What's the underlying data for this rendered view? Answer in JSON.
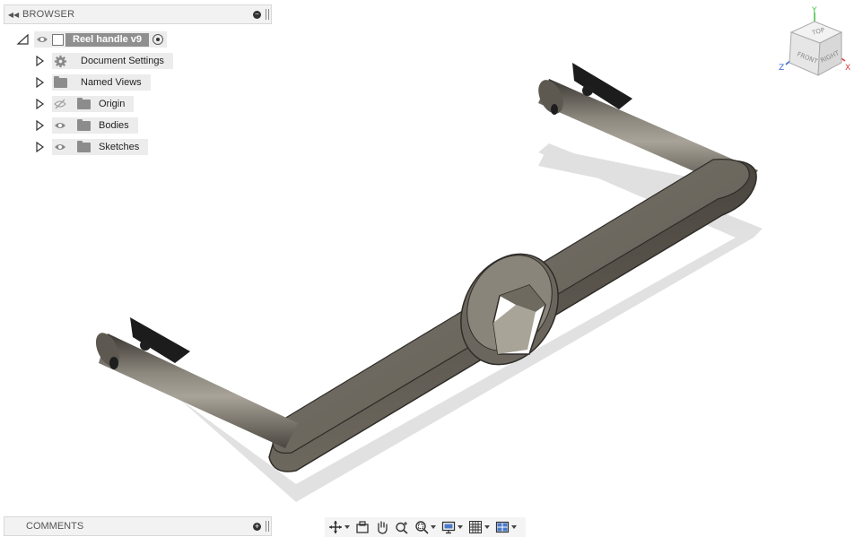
{
  "browser": {
    "title": "BROWSER",
    "root": {
      "label": "Reel handle v9"
    },
    "items": [
      {
        "label": "Document Settings",
        "icon": "gear-icon",
        "visibility": "none"
      },
      {
        "label": "Named Views",
        "icon": "folder-icon",
        "visibility": "none"
      },
      {
        "label": "Origin",
        "icon": "folder-icon",
        "visibility": "hidden"
      },
      {
        "label": "Bodies",
        "icon": "folder-icon",
        "visibility": "visible"
      },
      {
        "label": "Sketches",
        "icon": "folder-icon",
        "visibility": "visible"
      }
    ]
  },
  "comments": {
    "title": "COMMENTS"
  },
  "viewcube": {
    "top": "TOP",
    "front": "FRONT",
    "right": "RIGHT",
    "axis_x": "X",
    "axis_y": "Y",
    "axis_z": "Z"
  },
  "toolbar": {
    "tools": [
      "orbit-icon",
      "look-at-icon",
      "pan-icon",
      "zoom-icon",
      "fit-icon",
      "display-settings-icon",
      "grid-settings-icon",
      "viewports-icon"
    ]
  },
  "colors": {
    "model": "#6b665d",
    "panel": "#f2f2f2",
    "axis_x": "#e03a3a",
    "axis_y": "#3fbf3f",
    "axis_z": "#3a63d6"
  }
}
